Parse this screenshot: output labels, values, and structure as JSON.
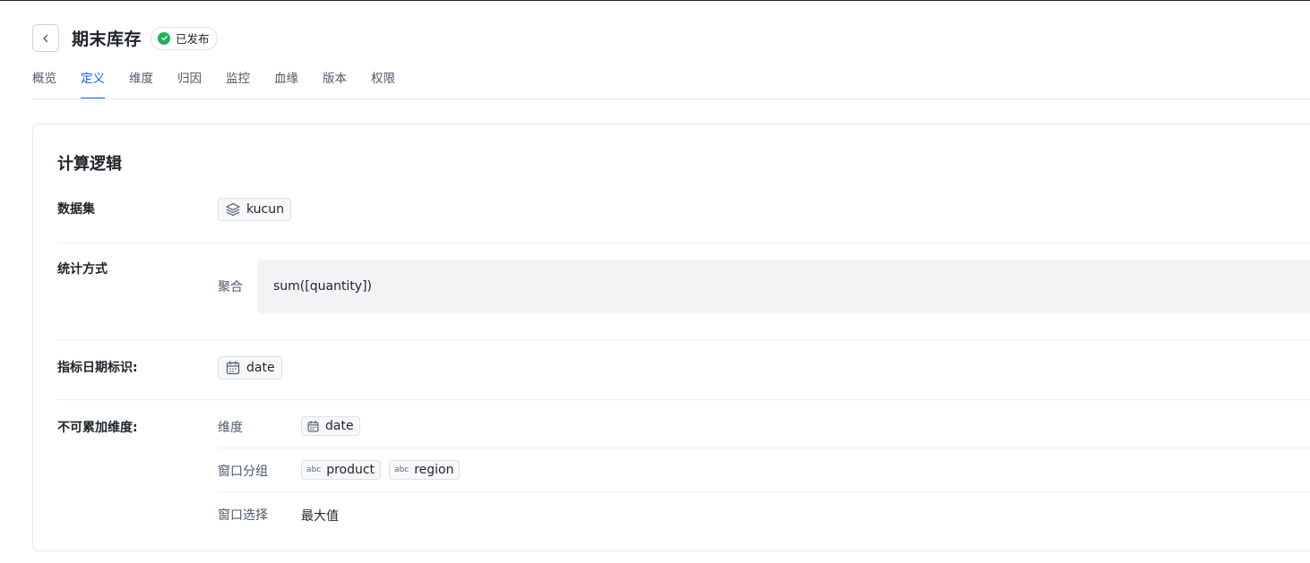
{
  "header": {
    "title": "期末库存",
    "status": "已发布",
    "status_color": "#1eb456"
  },
  "tabs": [
    {
      "label": "概览",
      "active": false
    },
    {
      "label": "定义",
      "active": true
    },
    {
      "label": "维度",
      "active": false
    },
    {
      "label": "归因",
      "active": false
    },
    {
      "label": "监控",
      "active": false
    },
    {
      "label": "血缘",
      "active": false
    },
    {
      "label": "版本",
      "active": false
    },
    {
      "label": "权限",
      "active": false
    }
  ],
  "accent_color": "#1664ff",
  "card": {
    "title": "计算逻辑",
    "dataset": {
      "label": "数据集",
      "value": "kucun",
      "icon": "layers-icon"
    },
    "stat": {
      "label": "统计方式",
      "sub_label": "聚合",
      "expression": "sum([quantity])"
    },
    "date_field": {
      "label": "指标日期标识:",
      "value": "date",
      "icon": "calendar-icon"
    },
    "non_additive": {
      "label": "不可累加维度:",
      "dimension_label": "维度",
      "dimension_value": "date",
      "window_group_label": "窗口分组",
      "window_groups": [
        "product",
        "region"
      ],
      "window_group_icon_text": "abc",
      "window_select_label": "窗口选择",
      "window_select_value": "最大值"
    }
  }
}
